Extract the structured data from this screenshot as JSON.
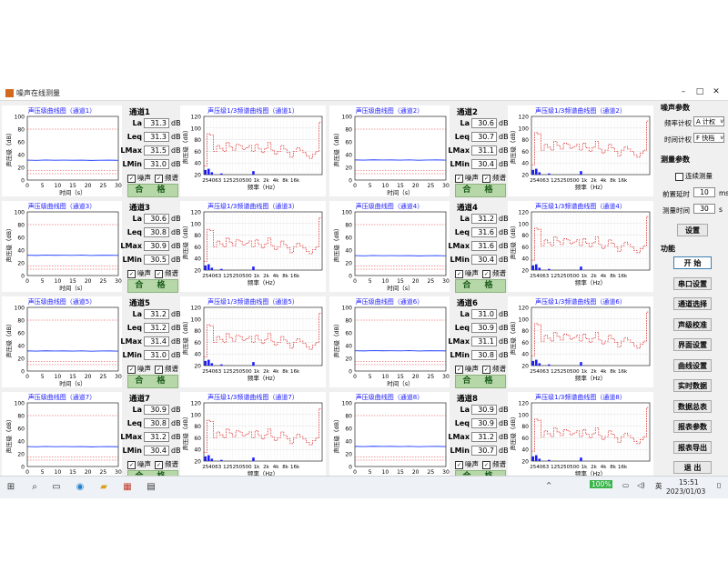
{
  "window": {
    "title": "噪声在线测量"
  },
  "plots": {
    "level_axis": {
      "ylabel": "声压级（dB）",
      "xlabel": "时间（s）",
      "yticks": [
        "0",
        "20",
        "40",
        "60",
        "80",
        "100"
      ],
      "xticks": [
        "0",
        "5",
        "10",
        "15",
        "20",
        "25",
        "30"
      ]
    },
    "spectrum_axis": {
      "ylabel": "声压级（dB）",
      "xlabel": "频率（Hz）",
      "yticks": [
        "20",
        "40",
        "60",
        "80",
        "100",
        "120"
      ],
      "xticks": [
        "25",
        "40",
        "63",
        "125",
        "250",
        "500",
        "1k",
        "2k",
        "4k",
        "8k",
        "16k"
      ]
    }
  },
  "channels": [
    {
      "name": "通道1",
      "level_title": "声压级曲线图（通道1）",
      "spectrum_title": "声压级1/3频谱曲线图（通道1）",
      "La": "31.3",
      "Leq": "31.3",
      "LMax": "31.5",
      "LMin": "31.0"
    },
    {
      "name": "通道2",
      "level_title": "声压级曲线图（通道2）",
      "spectrum_title": "声压级1/3频谱曲线图（通道2）",
      "La": "30.6",
      "Leq": "30.7",
      "LMax": "31.1",
      "LMin": "30.4"
    },
    {
      "name": "通道3",
      "level_title": "声压级曲线图（通道3）",
      "spectrum_title": "声压级1/3频谱曲线图（通道3）",
      "La": "30.6",
      "Leq": "30.8",
      "LMax": "30.9",
      "LMin": "30.5"
    },
    {
      "name": "通道4",
      "level_title": "声压级曲线图（通道4）",
      "spectrum_title": "声压级1/3频谱曲线图（通道4）",
      "La": "31.2",
      "Leq": "31.6",
      "LMax": "31.6",
      "LMin": "30.4"
    },
    {
      "name": "通道5",
      "level_title": "声压级曲线图（通道5）",
      "spectrum_title": "声压级1/3频谱曲线图（通道5）",
      "La": "31.2",
      "Leq": "31.2",
      "LMax": "31.4",
      "LMin": "31.0"
    },
    {
      "name": "通道6",
      "level_title": "声压级曲线图（通道6）",
      "spectrum_title": "声压级1/3频谱曲线图（通道6）",
      "La": "31.0",
      "Leq": "30.9",
      "LMax": "31.1",
      "LMin": "30.8"
    },
    {
      "name": "通道7",
      "level_title": "声压级曲线图（通道7）",
      "spectrum_title": "声压级1/3频谱曲线图（通道7）",
      "La": "30.9",
      "Leq": "30.8",
      "LMax": "31.2",
      "LMin": "30.4"
    },
    {
      "name": "通道8",
      "level_title": "声压级曲线图（通道8）",
      "spectrum_title": "声压级1/3频谱曲线图（通道8）",
      "La": "30.9",
      "Leq": "30.9",
      "LMax": "31.2",
      "LMin": "30.7"
    }
  ],
  "metric_labels": {
    "La": "La",
    "Leq": "Leq",
    "LMax": "LMax",
    "LMin": "LMin",
    "unit": "dB"
  },
  "checks": {
    "noise": "噪声",
    "spectrum": "频谱"
  },
  "pass_label": "合 格",
  "right_panel": {
    "noise_params": "噪声参数",
    "freq_weight_label": "频率计权",
    "freq_weight_value": "A 计权",
    "time_weight_label": "时间计权",
    "time_weight_value": "F 快档",
    "measure_params": "测量参数",
    "continuous_label": "连续测量",
    "pre_delay_label": "前置延时",
    "pre_delay_value": "10",
    "pre_delay_unit": "ms",
    "measure_time_label": "测量时间",
    "measure_time_value": "30",
    "measure_time_unit": "s",
    "settings_button": "设置",
    "functions": "功能",
    "buttons": [
      "开 始",
      "串口设置",
      "通道选择",
      "声级校准",
      "界面设置",
      "曲线设置",
      "实时数据",
      "数据总表",
      "报表参数",
      "报表导出",
      "退 出"
    ]
  },
  "taskbar": {
    "time": "15:51",
    "date": "2023/01/03",
    "battery": "100%",
    "lang": "英"
  },
  "chart_data": [
    {
      "type": "line",
      "title": "声压级曲线图（通道1）",
      "xlabel": "时间（s）",
      "ylabel": "声压级（dB）",
      "xlim": [
        0,
        30
      ],
      "ylim": [
        0,
        100
      ],
      "series": [
        {
          "values": [
            31.3,
            31.0,
            31.5,
            31.2,
            31.3,
            31.1,
            31.4
          ]
        }
      ],
      "x": [
        0,
        5,
        10,
        15,
        20,
        25,
        30
      ]
    },
    {
      "type": "bar",
      "title": "声压级1/3频谱曲线图（通道1）",
      "xlabel": "频率（Hz）",
      "ylabel": "声压级（dB）",
      "ylim": [
        20,
        120
      ],
      "categories": [
        "25",
        "40",
        "63",
        "125",
        "250",
        "500",
        "1k",
        "2k",
        "4k",
        "8k",
        "16k"
      ]
    }
  ]
}
